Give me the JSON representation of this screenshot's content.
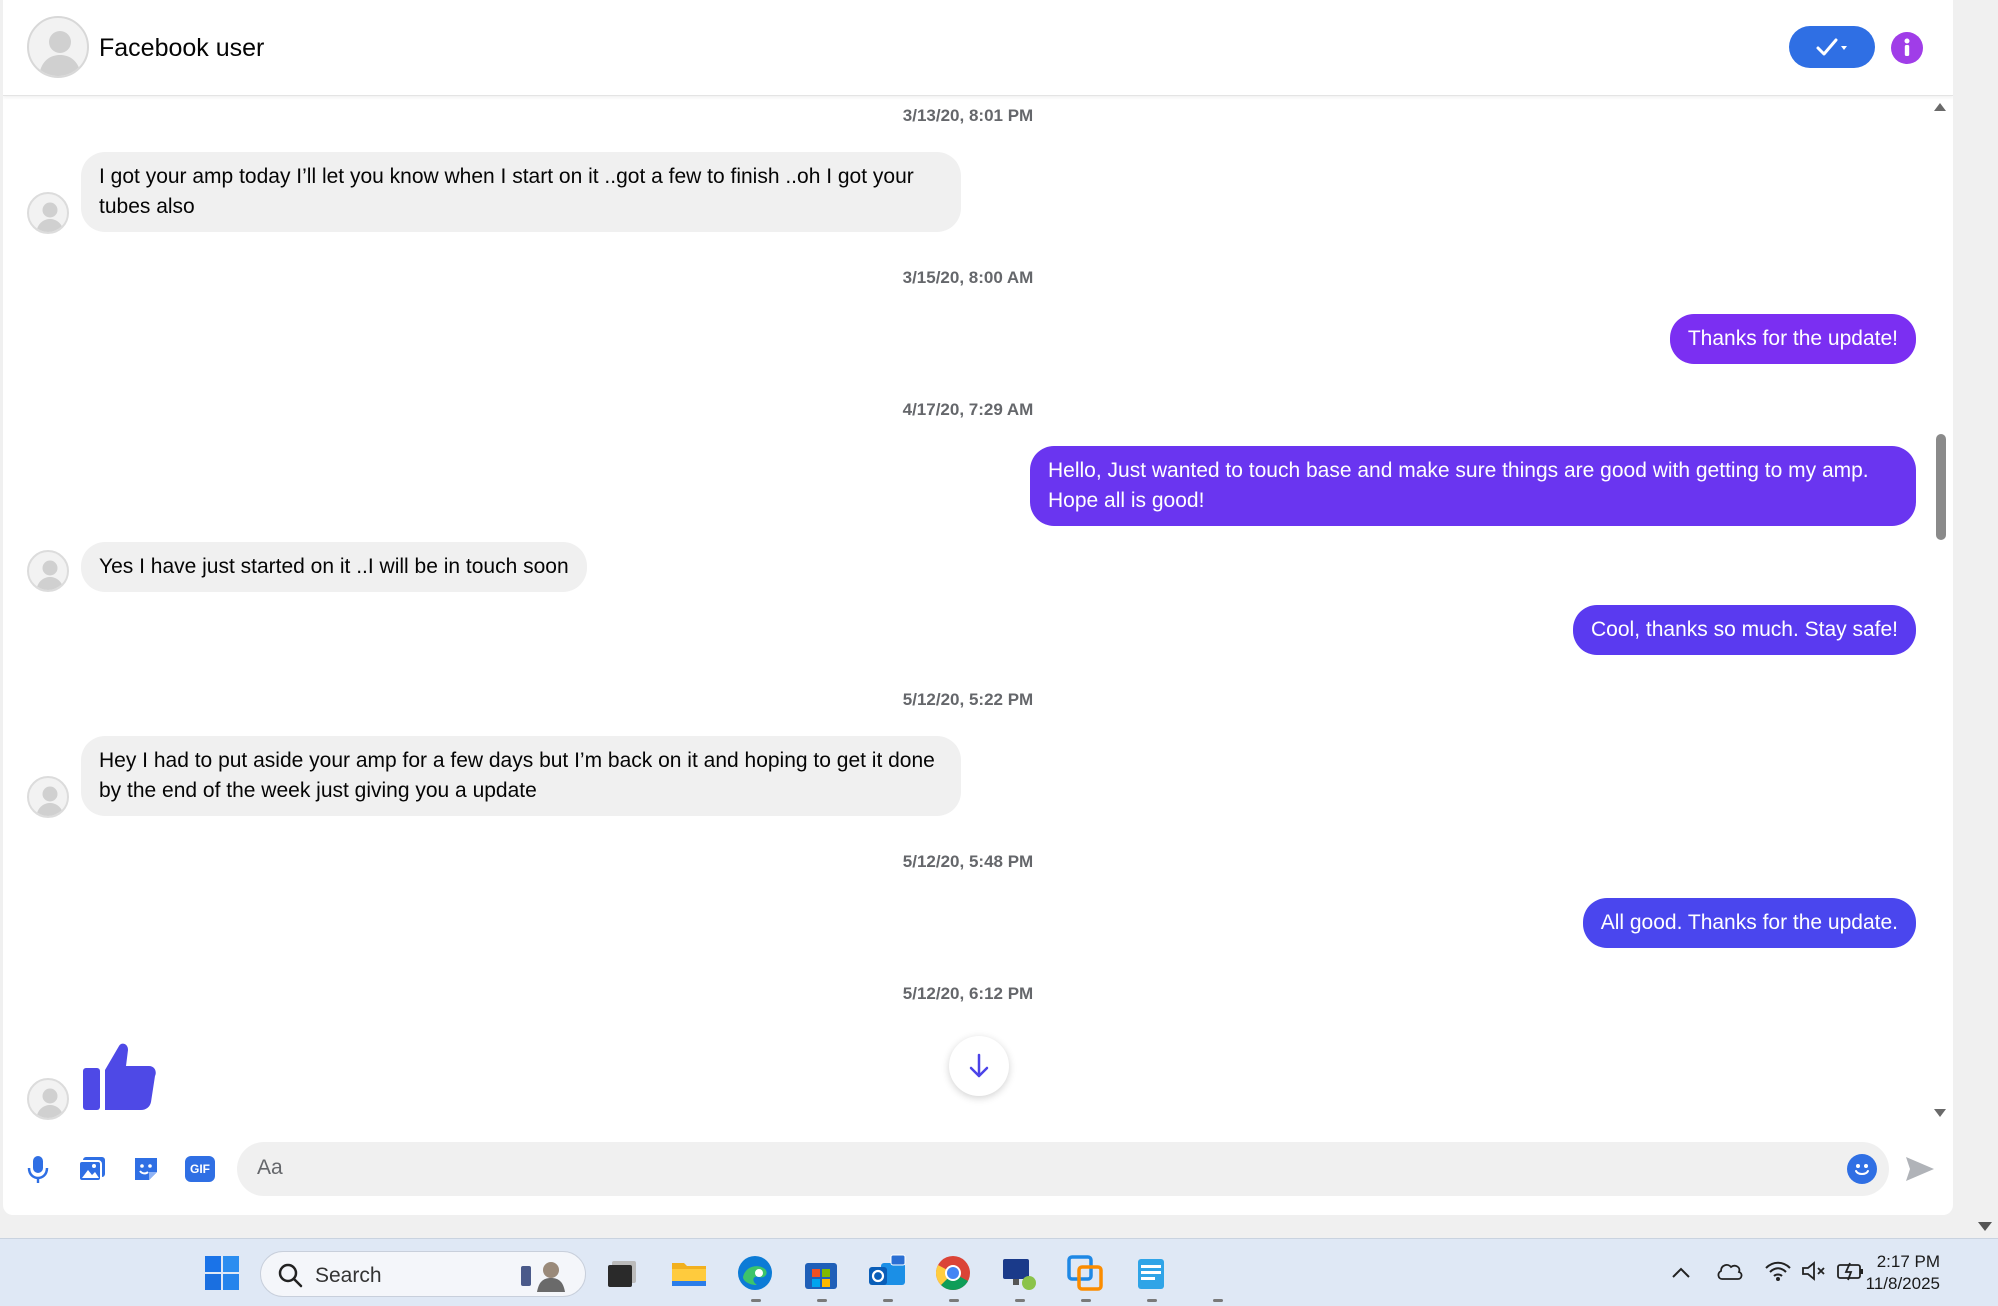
{
  "header": {
    "contact_name": "Facebook user",
    "check_icon": "check-icon",
    "info_icon": "info-icon"
  },
  "thread": {
    "items": [
      {
        "type": "timestamp",
        "text": "3/13/20, 8:01 PM"
      },
      {
        "type": "incoming",
        "text": "I got your amp today I’ll let you know when I start on it ..got a few to finish ..oh I got your tubes also"
      },
      {
        "type": "timestamp",
        "text": "3/15/20, 8:00 AM"
      },
      {
        "type": "outgoing",
        "text": "Thanks for the update!"
      },
      {
        "type": "timestamp",
        "text": "4/17/20, 7:29 AM"
      },
      {
        "type": "outgoing",
        "text": "Hello,  Just wanted to touch base and make sure things are good with getting to my amp.  Hope all is good!"
      },
      {
        "type": "incoming",
        "text": "Yes I have just started on it ..I will be in touch soon"
      },
      {
        "type": "outgoing",
        "text": "Cool, thanks so much.  Stay safe!"
      },
      {
        "type": "timestamp",
        "text": "5/12/20, 5:22 PM"
      },
      {
        "type": "incoming",
        "text": "Hey I had to put aside your amp for a few days but I’m back on it and hoping to get it done by the end of the week just giving you a update"
      },
      {
        "type": "timestamp",
        "text": "5/12/20, 5:48 PM"
      },
      {
        "type": "outgoing",
        "text": "All good.  Thanks for the update."
      },
      {
        "type": "timestamp",
        "text": "5/12/20, 6:12 PM"
      },
      {
        "type": "incoming-like",
        "icon": "thumbs-up-icon"
      }
    ],
    "bubble_colors": {
      "incoming": "#f0f0f0",
      "outgoing_1": "#7b2ff2",
      "outgoing_2": "#6a35f0",
      "outgoing_3": "#5a3af0",
      "outgoing_4": "#4a46ee"
    }
  },
  "composer": {
    "placeholder": "Aa",
    "icons": [
      "microphone-icon",
      "image-icon",
      "sticker-icon",
      "gif-icon",
      "emoji-icon",
      "send-icon"
    ],
    "gif_label": "GIF"
  },
  "taskbar": {
    "search_placeholder": "Search",
    "time": "2:17 PM",
    "date": "11/8/2025",
    "apps": [
      "start-icon",
      "task-view-icon",
      "file-explorer-icon",
      "edge-icon",
      "store-icon",
      "outlook-icon",
      "chrome-icon",
      "remote-desktop-icon",
      "vmware-icon",
      "notepad-icon"
    ],
    "tray": [
      "chevron-up-icon",
      "cloud-icon",
      "wifi-icon",
      "volume-muted-icon",
      "battery-icon"
    ]
  }
}
